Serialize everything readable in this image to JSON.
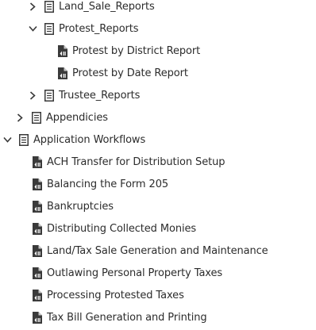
{
  "tree": {
    "land_sale_reports": {
      "label": "Land_Sale_Reports",
      "state": "collapsed",
      "icon": "document-outline-icon"
    },
    "protest_reports": {
      "label": "Protest_Reports",
      "state": "expanded",
      "icon": "document-outline-icon",
      "children": [
        {
          "label": "Protest by District Report",
          "icon": "pdf-document-icon"
        },
        {
          "label": "Protest by Date Report",
          "icon": "pdf-document-icon"
        }
      ]
    },
    "trustee_reports": {
      "label": "Trustee_Reports",
      "state": "collapsed",
      "icon": "document-outline-icon"
    },
    "appendicies": {
      "label": "Appendicies",
      "state": "collapsed",
      "icon": "document-outline-icon"
    },
    "application_workflows": {
      "label": "Application Workflows",
      "state": "expanded",
      "icon": "document-outline-icon",
      "children": [
        {
          "label": "ACH Transfer for Distribution Setup",
          "icon": "pdf-document-icon"
        },
        {
          "label": "Balancing the Form 205",
          "icon": "pdf-document-icon"
        },
        {
          "label": "Bankruptcies",
          "icon": "pdf-document-icon"
        },
        {
          "label": "Distributing Collected Monies",
          "icon": "pdf-document-icon"
        },
        {
          "label": "Land/Tax Sale Generation and Maintenance",
          "icon": "pdf-document-icon"
        },
        {
          "label": "Outlawing Personal Property Taxes",
          "icon": "pdf-document-icon"
        },
        {
          "label": "Processing Protested Taxes",
          "icon": "pdf-document-icon"
        },
        {
          "label": "Tax Bill Generation and Printing",
          "icon": "pdf-document-icon"
        }
      ]
    }
  }
}
